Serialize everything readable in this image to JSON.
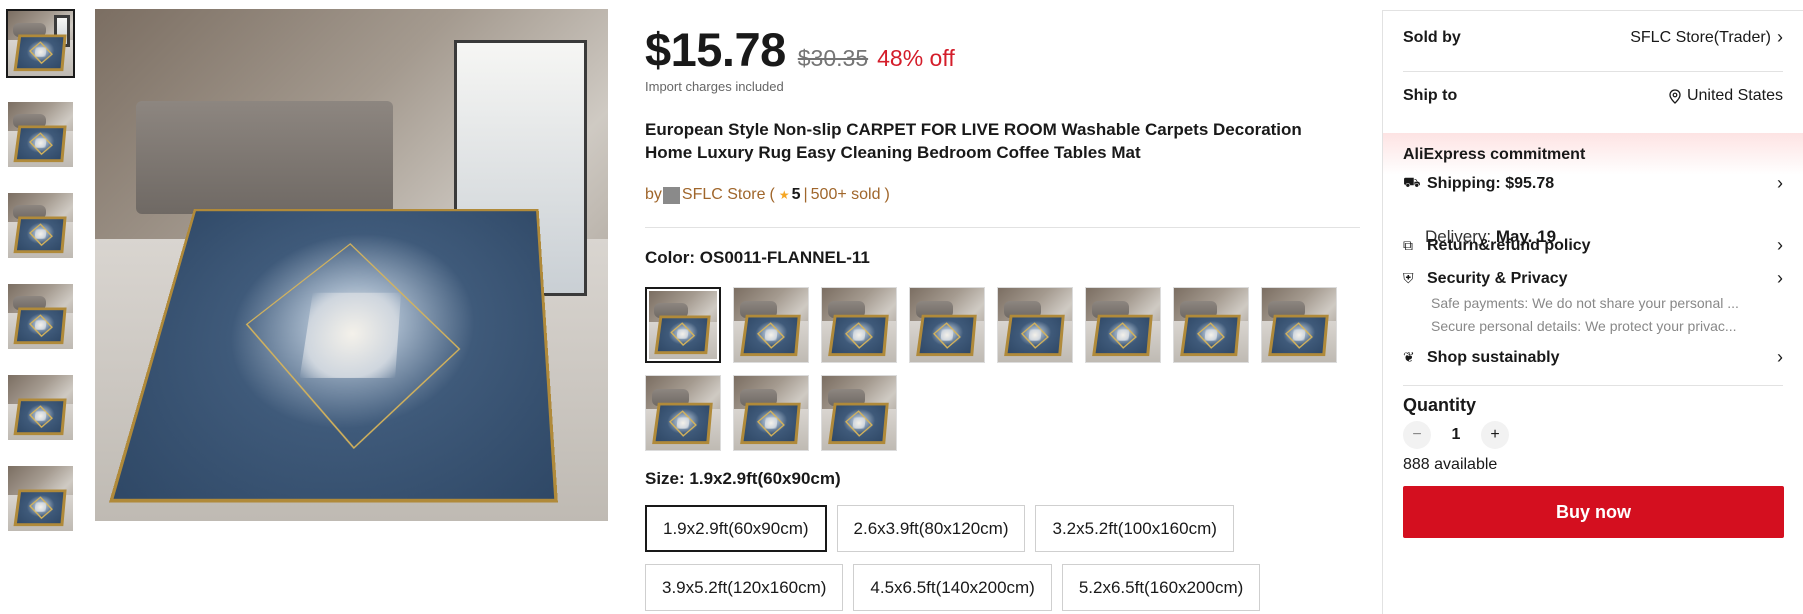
{
  "product": {
    "price": "$15.78",
    "original_price": "$30.35",
    "discount": "48% off",
    "import_note": "Import charges included",
    "title": "European Style Non-slip CARPET FOR LIVE ROOM Washable Carpets Decoration Home Luxury Rug Easy Cleaning Bedroom Coffee Tables Mat",
    "by": "by",
    "store": "SFLC Store",
    "open_paren": "(",
    "rating": "5",
    "separator": "|",
    "sold": "500+ sold",
    "close_paren": ")"
  },
  "gallery": {
    "thumb_count": 6,
    "active_index": 0
  },
  "color": {
    "label": "Color:",
    "value": "OS0011-FLANNEL-11",
    "swatch_count": 11,
    "selected_index": 0
  },
  "size": {
    "label": "Size:",
    "value": "1.9x2.9ft(60x90cm)",
    "options": [
      "1.9x2.9ft(60x90cm)",
      "2.6x3.9ft(80x120cm)",
      "3.2x5.2ft(100x160cm)",
      "3.9x5.2ft(120x160cm)",
      "4.5x6.5ft(140x200cm)",
      "5.2x6.5ft(160x200cm)"
    ],
    "selected_index": 0
  },
  "panel": {
    "sold_by_label": "Sold by",
    "sold_by_value": "SFLC Store(Trader)",
    "ship_to_label": "Ship to",
    "ship_to_value": "United States",
    "commitment_title": "AliExpress commitment",
    "shipping_label": "Shipping:",
    "shipping_value": "$95.78",
    "delivery_label": "Delivery:",
    "delivery_value": "May. 19",
    "return_label": "Return&refund policy",
    "security_label": "Security & Privacy",
    "security_sub1": "Safe payments: We do not share your personal ...",
    "security_sub2": "Secure personal details: We protect your privac...",
    "sustain_label": "Shop sustainably",
    "quantity_label": "Quantity",
    "quantity_value": "1",
    "available": "888 available",
    "buy_now": "Buy now"
  },
  "colors": {
    "price_red": "#d41d2a",
    "buy_button": "#d40f1f",
    "store_link": "#a0662b",
    "star": "#f5a623"
  },
  "icons": {
    "ship_to": "location-pin-icon",
    "shipping": "truck-icon",
    "return": "return-box-icon",
    "security": "shield-check-icon",
    "sustain": "leaf-icon",
    "chevron": "chevron-right-icon"
  }
}
